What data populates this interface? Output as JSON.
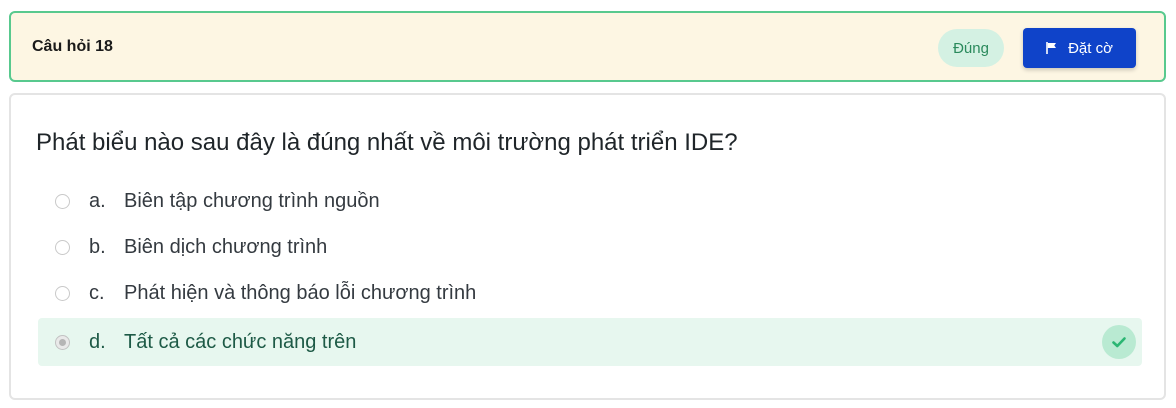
{
  "header": {
    "title": "Câu hỏi 18",
    "status": "Đúng",
    "flag_label": "Đặt cờ"
  },
  "question": {
    "text": "Phát biểu nào sau đây là đúng nhất về môi trường phát triển IDE?",
    "options": [
      {
        "letter": "a.",
        "text": "Biên tập chương trình nguồn",
        "selected": false,
        "correct": false
      },
      {
        "letter": "b.",
        "text": "Biên dịch chương trình",
        "selected": false,
        "correct": false
      },
      {
        "letter": "c.",
        "text": "Phát hiện và thông báo lỗi chương trình",
        "selected": false,
        "correct": false
      },
      {
        "letter": "d.",
        "text": "Tất cả các chức năng trên",
        "selected": true,
        "correct": true
      }
    ]
  },
  "colors": {
    "header_bg": "#fdf6e3",
    "header_border": "#58c98e",
    "status_bg": "#d4f1e3",
    "status_text": "#2a8a5c",
    "flag_button_bg": "#0f43c9",
    "correct_bg": "#e7f7ef",
    "check_color": "#2bb673"
  },
  "icons": {
    "flag": "flag-icon",
    "check": "check-icon"
  }
}
